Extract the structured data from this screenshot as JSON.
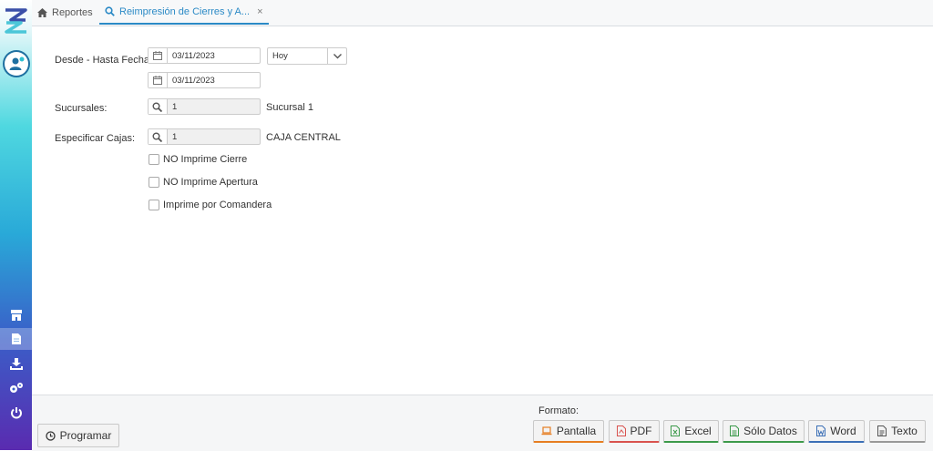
{
  "tabs": {
    "home_label": "Reportes",
    "active_label": "Reimpresión de Cierres y A...",
    "close_glyph": "×"
  },
  "form": {
    "fecha_label": "Desde - Hasta Fecha:",
    "desde_value": "03/11/2023",
    "hasta_value": "03/11/2023",
    "periodo_value": "Hoy",
    "sucursales_label": "Sucursales:",
    "sucursal_code": "1",
    "sucursal_name": "Sucursal 1",
    "cajas_label": "Especificar Cajas:",
    "caja_code": "1",
    "caja_name": "CAJA CENTRAL"
  },
  "checkboxes": {
    "no_cierre": "NO Imprime Cierre",
    "no_apertura": "NO Imprime Apertura",
    "comandera": "Imprime por Comandera"
  },
  "footer": {
    "programar_label": "Programar",
    "formato_label": "Formato:",
    "pantalla_label": "Pantalla",
    "pdf_label": "PDF",
    "excel_label": "Excel",
    "solo_datos_label": "Sólo Datos",
    "word_label": "Word",
    "texto_label": "Texto"
  },
  "colors": {
    "accent": "#2b8ac6",
    "pantalla": "#e67e22",
    "pdf": "#d9534f",
    "excel": "#3c9a4b",
    "word": "#3b6fb6"
  }
}
